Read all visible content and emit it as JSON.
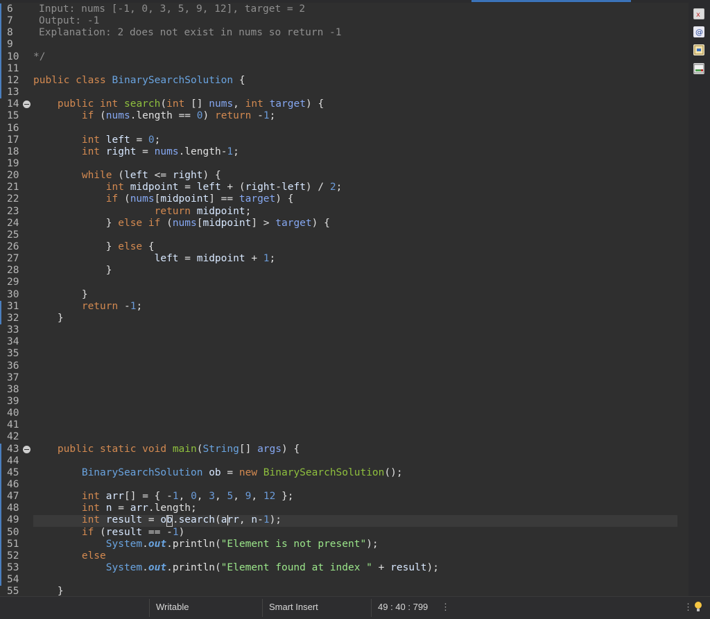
{
  "editor": {
    "lines": [
      {
        "n": "6",
        "code": "Input: nums [-1, 0, 3, 5, 9, 12], target = 2"
      },
      {
        "n": "7",
        "code": "Output: -1"
      },
      {
        "n": "8",
        "code": "Explanation: 2 does not exist in nums so return -1"
      },
      {
        "n": "9",
        "code": ""
      },
      {
        "n": "10",
        "code": "*/"
      },
      {
        "n": "11",
        "code": ""
      },
      {
        "n": "12",
        "code": "public class BinarySearchSolution {"
      },
      {
        "n": "13",
        "code": ""
      },
      {
        "n": "14",
        "code": "    public int search(int [] nums, int target) {"
      },
      {
        "n": "15",
        "code": "        if (nums.length == 0) return -1;"
      },
      {
        "n": "16",
        "code": ""
      },
      {
        "n": "17",
        "code": "        int left = 0;"
      },
      {
        "n": "18",
        "code": "        int right = nums.length-1;"
      },
      {
        "n": "19",
        "code": ""
      },
      {
        "n": "20",
        "code": "        while (left <= right) {"
      },
      {
        "n": "21",
        "code": "            int midpoint = left + (right-left) / 2;"
      },
      {
        "n": "22",
        "code": "            if (nums[midpoint] == target) {"
      },
      {
        "n": "23",
        "code": "                    return midpoint;"
      },
      {
        "n": "24",
        "code": "            } else if (nums[midpoint] > target) {"
      },
      {
        "n": "25",
        "code": ""
      },
      {
        "n": "26",
        "code": "            } else {"
      },
      {
        "n": "27",
        "code": "                    left = midpoint + 1;"
      },
      {
        "n": "28",
        "code": "            }"
      },
      {
        "n": "29",
        "code": ""
      },
      {
        "n": "30",
        "code": "        }"
      },
      {
        "n": "31",
        "code": "        return -1;"
      },
      {
        "n": "32",
        "code": "    }"
      },
      {
        "n": "33",
        "code": ""
      },
      {
        "n": "34",
        "code": ""
      },
      {
        "n": "35",
        "code": ""
      },
      {
        "n": "36",
        "code": ""
      },
      {
        "n": "37",
        "code": ""
      },
      {
        "n": "38",
        "code": ""
      },
      {
        "n": "39",
        "code": ""
      },
      {
        "n": "40",
        "code": ""
      },
      {
        "n": "41",
        "code": ""
      },
      {
        "n": "42",
        "code": ""
      },
      {
        "n": "43",
        "code": "    public static void main(String[] args) {"
      },
      {
        "n": "44",
        "code": ""
      },
      {
        "n": "45",
        "code": "        BinarySearchSolution ob = new BinarySearchSolution();"
      },
      {
        "n": "46",
        "code": ""
      },
      {
        "n": "47",
        "code": "        int arr[] = { -1, 0, 3, 5, 9, 12 };"
      },
      {
        "n": "48",
        "code": "        int n = arr.length;"
      },
      {
        "n": "49",
        "code": "        int result = ob.search(arr, n-1);"
      },
      {
        "n": "50",
        "code": "        if (result == -1)"
      },
      {
        "n": "51",
        "code": "            System.out.println(\"Element is not present\");"
      },
      {
        "n": "52",
        "code": "        else"
      },
      {
        "n": "53",
        "code": "            System.out.println(\"Element found at index \" + result);"
      },
      {
        "n": "54",
        "code": ""
      },
      {
        "n": "55",
        "code": "    }"
      }
    ]
  },
  "statusbar": {
    "mode": "Writable",
    "insert_mode": "Smart Insert",
    "position": "49 : 40 : 799"
  },
  "right_rail": {
    "icons": [
      "error-marker-icon",
      "javadoc-icon",
      "declaration-icon",
      "console-icon"
    ]
  },
  "colors": {
    "keyword": "#d48a51",
    "method": "#8fc03e",
    "type": "#6aa4e0",
    "number": "#6b9bd8",
    "string": "#9be68a",
    "comment": "#8f8f8f"
  }
}
